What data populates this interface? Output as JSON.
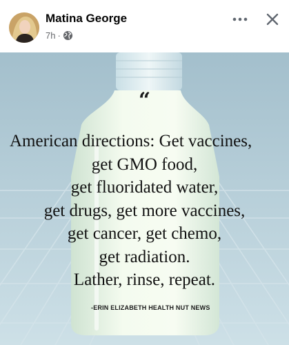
{
  "post": {
    "author_name": "Matina George",
    "timestamp": "7h",
    "separator": "·",
    "audience_icon": "globe-icon",
    "more_icon": "more-horizontal-icon",
    "close_icon": "close-icon"
  },
  "image": {
    "quote_mark": "“",
    "quote_lines": [
      "American directions: Get vaccines,",
      "get GMO food,",
      "get fluoridated water,",
      "get drugs, get more vaccines,",
      "get cancer, get chemo,",
      "get radiation.",
      "Lather, rinse, repeat."
    ],
    "attribution": "-ERIN ELIZABETH HEALTH NUT NEWS"
  },
  "colors": {
    "author_text": "#050505",
    "meta_text": "#65676b",
    "icon_gray": "#606770",
    "image_background": "#b3cdd8",
    "quote_text": "#111111"
  }
}
